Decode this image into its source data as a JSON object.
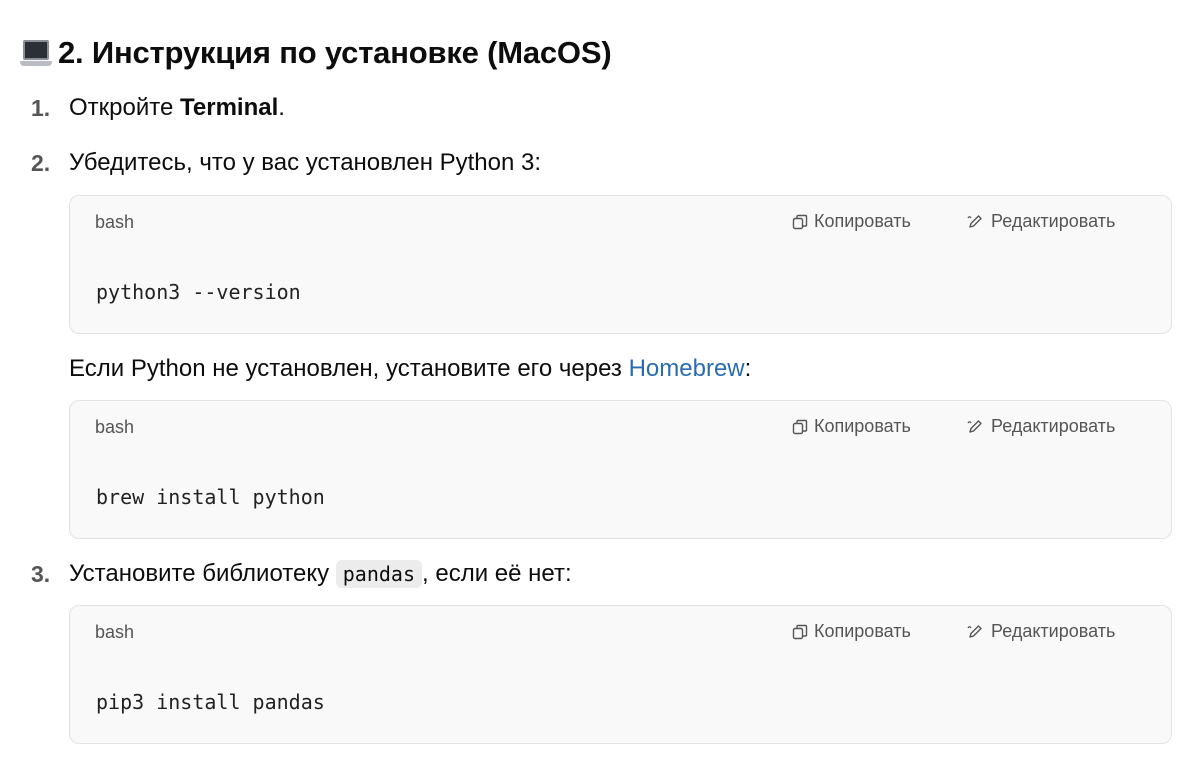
{
  "heading": {
    "number": "2.",
    "title": "Инструкция по установке (MacOS)"
  },
  "steps": [
    {
      "number": "1.",
      "prefix": "Откройте ",
      "bold": "Terminal",
      "suffix": "."
    },
    {
      "number": "2.",
      "text": "Убедитесь, что у вас установлен Python 3:",
      "code": {
        "lang": "bash",
        "command": "python3 --version"
      },
      "note": {
        "prefix": "Если Python не установлен, установите его через ",
        "link": "Homebrew",
        "suffix": ":"
      },
      "code2": {
        "lang": "bash",
        "command": "brew install python"
      }
    },
    {
      "number": "3.",
      "prefix": "Установите библиотеку ",
      "inline_code": "pandas",
      "suffix": ", если её нет:",
      "code": {
        "lang": "bash",
        "command": "pip3 install pandas"
      }
    }
  ],
  "actions": {
    "copy_label": "Копировать",
    "edit_label": "Редактировать"
  },
  "icons": {
    "heading": "laptop-icon",
    "copy": "copy-icon",
    "edit": "pencil-icon"
  },
  "colors": {
    "link": "#2b6cb0",
    "code_bg": "#f9f9f9"
  }
}
